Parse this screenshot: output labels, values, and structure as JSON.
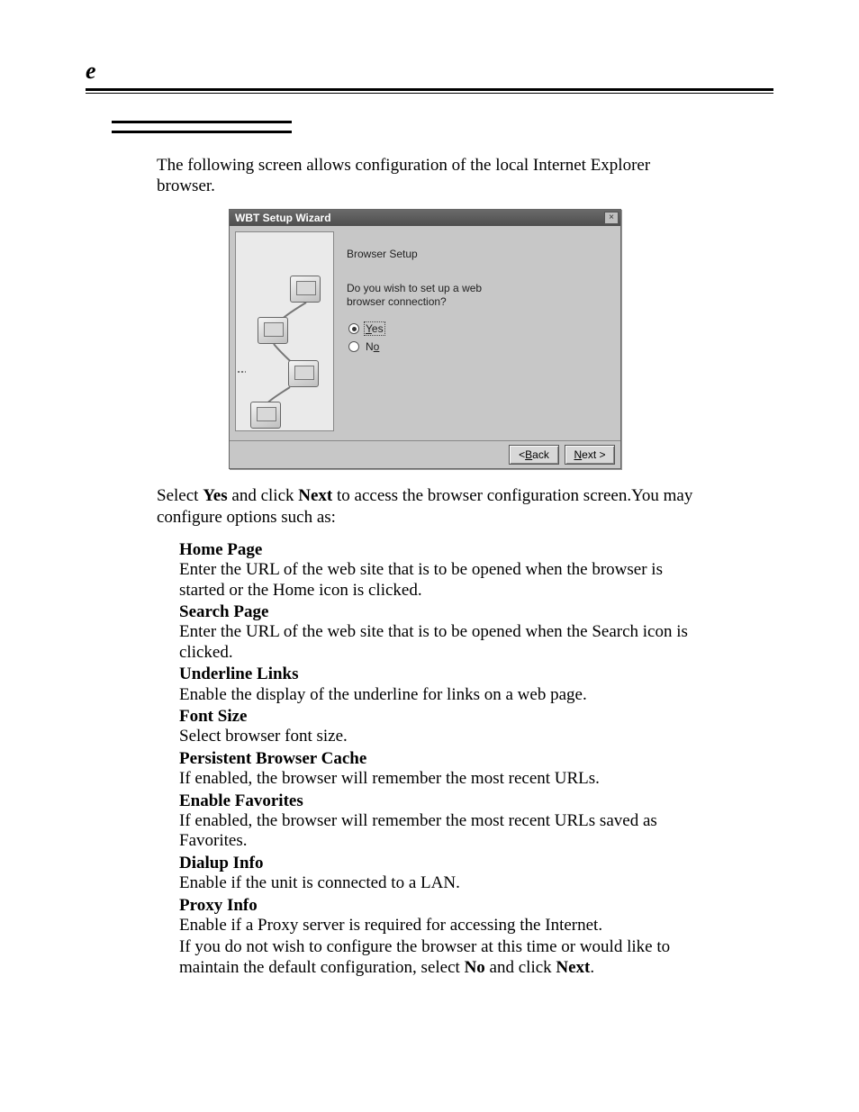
{
  "corner_mark": "e",
  "intro": "The following screen allows configuration of  the local Internet Explorer browser.",
  "wizard": {
    "title": "WBT Setup Wizard",
    "close_glyph": "×",
    "heading": "Browser Setup",
    "question": "Do you wish to set up a web browser connection?",
    "yes_label": "Yes",
    "no_label": "No",
    "back_label": "< Back",
    "next_label": "Next >"
  },
  "after": "Select Yes and click Next to access the browser configuration screen.You may configure options such as:",
  "defs": [
    {
      "title": "Home Page",
      "body": "Enter the URL of the web site that is to be opened when the browser is started or the Home icon is clicked."
    },
    {
      "title": "Search Page",
      "body": "Enter the URL of the web site that is to be opened when the Search icon is clicked."
    },
    {
      "title": "Underline Links",
      "body": "Enable the display of the underline for links on a web page."
    },
    {
      "title": "Font Size",
      "body": "Select browser font size."
    },
    {
      "title": "Persistent Browser Cache",
      "body": "If enabled, the browser will remember the most recent URLs."
    },
    {
      "title": "Enable Favorites",
      "body": "If enabled, the browser will remember the most recent URLs saved as Favorites."
    },
    {
      "title": "Dialup Info",
      "body": "Enable if the unit is connected to a LAN."
    },
    {
      "title": "Proxy Info",
      "body": "Enable if a Proxy server is required for accessing the Internet."
    }
  ],
  "closing": "If you do not wish to configure the browser at this time or would like to maintain the default configuration, select No and click Next."
}
